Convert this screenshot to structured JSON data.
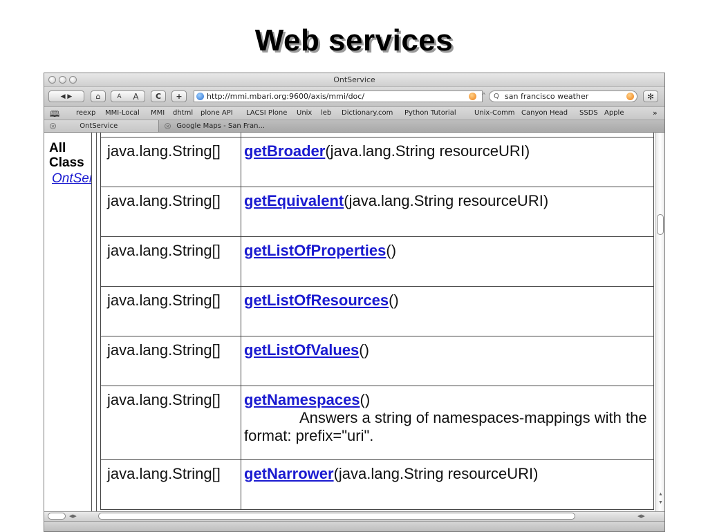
{
  "slide": {
    "title": "Web services"
  },
  "browser": {
    "window_title": "OntService",
    "toolbar": {
      "back_fwd": "◀ ▶",
      "home": "⌂",
      "text_smaller": "A",
      "text_larger": "A",
      "reload": "C",
      "add": "+"
    },
    "url": "http://mmi.mbari.org:9600/axis/mmi/doc/",
    "search_value": "san francisco weather",
    "bookmarks": [
      "reexp",
      "MMI-Local",
      "MMI",
      "dhtml",
      "plone API",
      "LACSI Plone",
      "Unix",
      "leb",
      "Dictionary.com",
      "Python Tutorial",
      "Unix-Comm",
      "Canyon Head",
      "SSDS",
      "Apple"
    ],
    "bookmarks_overflow": "»",
    "tabs": [
      {
        "label": "OntService",
        "active": true
      },
      {
        "label": "Google Maps - San Fran...",
        "active": false
      }
    ]
  },
  "left_frame": {
    "heading_line1": "All",
    "heading_line2": "Class",
    "link": "OntService"
  },
  "methods": [
    {
      "type": "java.lang.String[]",
      "name": "getBroader",
      "params": "(java.lang.String resourceURI)",
      "description": ""
    },
    {
      "type": "java.lang.String[]",
      "name": "getEquivalent",
      "params": "(java.lang.String resourceURI)",
      "description": ""
    },
    {
      "type": "java.lang.String[]",
      "name": "getListOfProperties",
      "params": "()",
      "description": ""
    },
    {
      "type": "java.lang.String[]",
      "name": "getListOfResources",
      "params": "()",
      "description": ""
    },
    {
      "type": "java.lang.String[]",
      "name": "getListOfValues",
      "params": "()",
      "description": ""
    },
    {
      "type": "java.lang.String[]",
      "name": "getNamespaces",
      "params": "()",
      "description": "Answers a string of namespaces-mappings with the format: prefix=\"uri\"."
    },
    {
      "type": "java.lang.String[]",
      "name": "getNarrower",
      "params": "(java.lang.String resourceURI)",
      "description": ""
    }
  ]
}
